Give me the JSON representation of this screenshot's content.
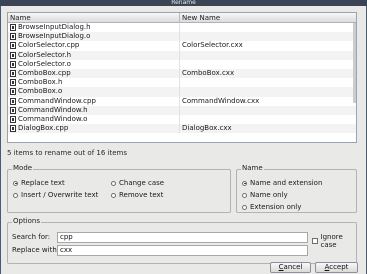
{
  "window": {
    "title": "Rename"
  },
  "table": {
    "headers": [
      "Name",
      "New Name"
    ],
    "rows": [
      {
        "name": "BrowseInputDialog.h",
        "new_name": ""
      },
      {
        "name": "BrowseInputDialog.o",
        "new_name": ""
      },
      {
        "name": "ColorSelector.cpp",
        "new_name": "ColorSelector.cxx"
      },
      {
        "name": "ColorSelector.h",
        "new_name": ""
      },
      {
        "name": "ColorSelector.o",
        "new_name": ""
      },
      {
        "name": "ComboBox.cpp",
        "new_name": "ComboBox.cxx"
      },
      {
        "name": "ComboBox.h",
        "new_name": ""
      },
      {
        "name": "ComboBox.o",
        "new_name": ""
      },
      {
        "name": "CommandWindow.cpp",
        "new_name": "CommandWindow.cxx"
      },
      {
        "name": "CommandWindow.h",
        "new_name": ""
      },
      {
        "name": "CommandWindow.o",
        "new_name": ""
      },
      {
        "name": "DialogBox.cpp",
        "new_name": "DialogBox.cxx"
      }
    ]
  },
  "status": "5 items to rename out of 16 items",
  "mode": {
    "title": "Mode",
    "options": [
      {
        "label": "Replace text",
        "selected": true
      },
      {
        "label": "Change case",
        "selected": false
      },
      {
        "label": "Insert / Overwrite text",
        "selected": false
      },
      {
        "label": "Remove text",
        "selected": false
      }
    ]
  },
  "name": {
    "title": "Name",
    "options": [
      {
        "label": "Name and extension",
        "selected": true
      },
      {
        "label": "Name only",
        "selected": false
      },
      {
        "label": "Extension only",
        "selected": false
      }
    ]
  },
  "options": {
    "title": "Options",
    "search_label": "Search for:",
    "search_value": "cpp",
    "replace_label": "Replace with:",
    "replace_value": "cxx",
    "ignore_case_label": "Ignore case",
    "ignore_case_checked": false
  },
  "buttons": {
    "cancel": {
      "first": "C",
      "rest": "ancel"
    },
    "accept": {
      "first": "A",
      "rest": "ccept"
    }
  }
}
